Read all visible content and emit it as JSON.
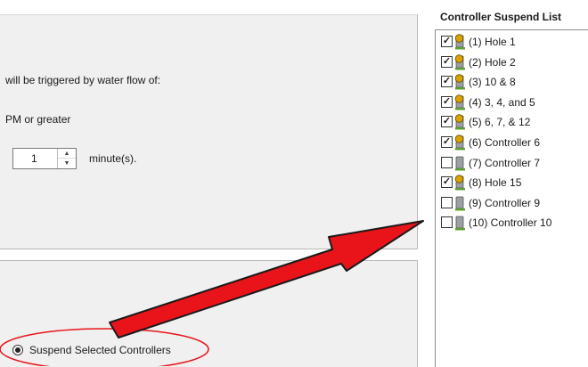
{
  "settings": {
    "trigger_text": "will be triggered by water flow of:",
    "flow_threshold_text": "PM or greater",
    "duration_value": "1",
    "duration_unit": "minute(s)."
  },
  "action": {
    "suspend_label": "Suspend Selected Controllers",
    "suspend_selected": true
  },
  "suspend_list": {
    "title": "Controller Suspend List",
    "items": [
      {
        "label": "(1)  Hole 1",
        "checked": true,
        "icon": "controller-active-icon"
      },
      {
        "label": "(2)  Hole 2",
        "checked": true,
        "icon": "controller-active-icon"
      },
      {
        "label": "(3)  10 & 8",
        "checked": true,
        "icon": "controller-active-icon"
      },
      {
        "label": "(4)  3, 4, and 5",
        "checked": true,
        "icon": "controller-active-icon"
      },
      {
        "label": "(5)  6, 7, & 12",
        "checked": true,
        "icon": "controller-active-icon"
      },
      {
        "label": "(6)  Controller 6",
        "checked": true,
        "icon": "controller-active-icon"
      },
      {
        "label": "(7)  Controller 7",
        "checked": false,
        "icon": "controller-inactive-icon"
      },
      {
        "label": "(8)  Hole 15",
        "checked": true,
        "icon": "controller-active-icon"
      },
      {
        "label": "(9)  Controller 9",
        "checked": false,
        "icon": "controller-inactive-icon"
      },
      {
        "label": "(10)  Controller 10",
        "checked": false,
        "icon": "controller-inactive-icon"
      }
    ]
  },
  "colors": {
    "annotation_red": "#e8141a",
    "panel_bg": "#f0f0f0",
    "controller_active": "#d8a200",
    "controller_body": "#9aa0a4",
    "controller_base": "#5da02e"
  }
}
